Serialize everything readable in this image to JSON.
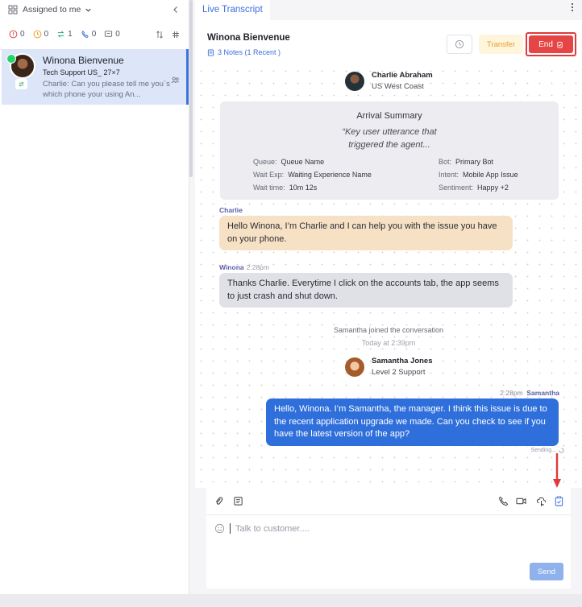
{
  "sidebar": {
    "filter_label": "Assigned to me",
    "counts": [
      {
        "icon": "alert-icon",
        "value": "0",
        "color": "#e04848"
      },
      {
        "icon": "clock-icon",
        "value": "0",
        "color": "#f0a030"
      },
      {
        "icon": "transfer-icon",
        "value": "1",
        "color": "#2fa66a"
      },
      {
        "icon": "phone-icon",
        "value": "0",
        "color": "#3a6fdc"
      },
      {
        "icon": "message-icon",
        "value": "0",
        "color": "#6a6a78"
      }
    ],
    "conversation": {
      "name": "Winona Bienvenue",
      "queue": "Tech Support US_ 27×7",
      "preview": "Charlie: Can you please tell me you`s which phone your using An..."
    }
  },
  "tab": {
    "label": "Live Transcript"
  },
  "header": {
    "customer_name": "Winona Bienvenue",
    "notes": "3 Notes (1 Recent )",
    "transfer_label": "Transfer",
    "end_label": "End"
  },
  "chat": {
    "agent1": {
      "name": "Charlie Abraham",
      "role": "US West Coast"
    },
    "arrival": {
      "title": "Arrival Summary",
      "quote_line1": "“Key user utterance that",
      "quote_line2": "triggered the agent...",
      "queue_label": "Queue:",
      "queue_value": "Queue Name",
      "waitexp_label": "Wait Exp:",
      "waitexp_value": "Waiting Experience Name",
      "waittime_label": "Wait time:",
      "waittime_value": "10m 12s",
      "bot_label": "Bot:",
      "bot_value": "Primary Bot",
      "intent_label": "Intent:",
      "intent_value": "Mobile App Issue",
      "sentiment_label": "Sentiment:",
      "sentiment_value": "Happy +2"
    },
    "msg1": {
      "sender": "Charlie",
      "text": "Hello Winona, I’m Charlie and I can help you with the issue you have on your phone."
    },
    "msg2": {
      "sender": "Winona",
      "time": "2:28pm",
      "text": "Thanks Charlie. Everytime I click on the accounts tab, the app seems to just crash and shut down."
    },
    "system_joined": "Samantha joined the conversation",
    "system_time": "Today at 2:39pm",
    "agent2": {
      "name": "Samantha Jones",
      "role": "Level 2 Support"
    },
    "msg3": {
      "time": "2:28pm",
      "sender": "Samantha",
      "text": "Hello, Winona. I’m Samantha, the manager. I think this issue is due to the recent application upgrade we made. Can you check to see if you have the latest version of the app?",
      "status": "Sending..."
    }
  },
  "composer": {
    "placeholder": "Talk to customer....",
    "send_label": "Send"
  },
  "colors": {
    "accent": "#3a6fdc",
    "end": "#e64545",
    "transfer_bg": "#fff4dc",
    "agent_bubble": "#f6e1c4",
    "customer_bubble": "#e0e1e7",
    "manager_bubble": "#2f6fdb"
  }
}
